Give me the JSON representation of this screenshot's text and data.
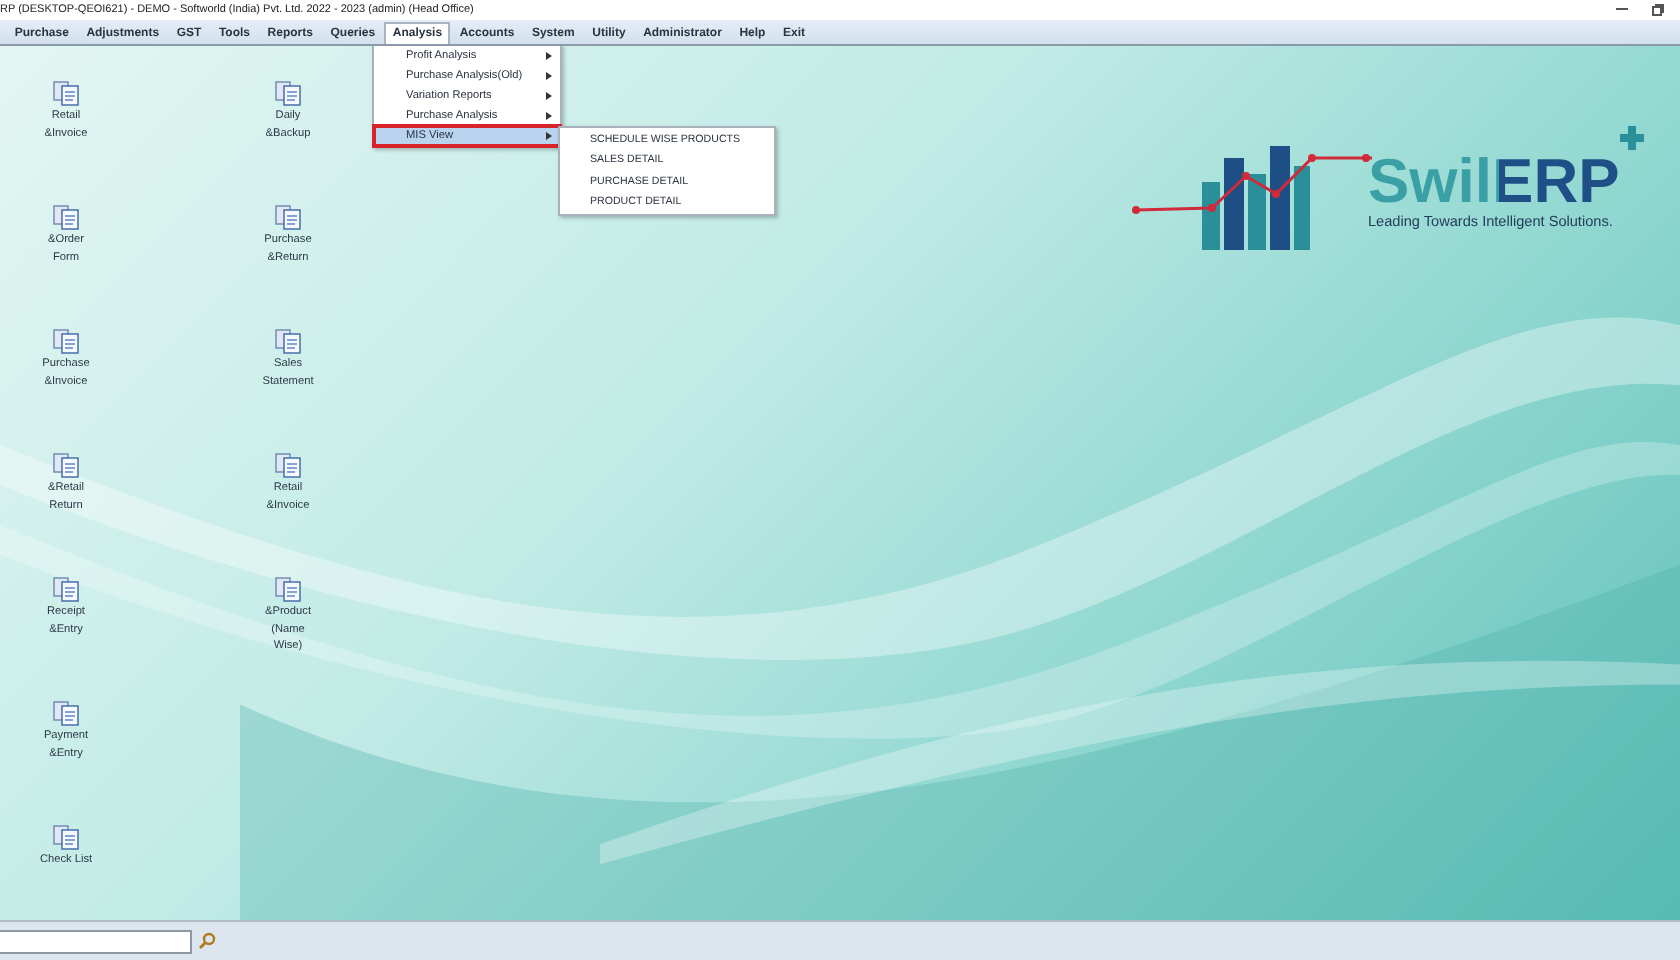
{
  "window": {
    "title": "RP (DESKTOP-QEOI621) - DEMO - Softworld (India) Pvt. Ltd. 2022 - 2023 (admin) (Head Office)"
  },
  "menu_bar": [
    {
      "label": "Purchase",
      "selected": false
    },
    {
      "label": "Adjustments",
      "selected": false
    },
    {
      "label": "GST",
      "selected": false
    },
    {
      "label": "Tools",
      "selected": false
    },
    {
      "label": "Reports",
      "selected": false
    },
    {
      "label": "Queries",
      "selected": false
    },
    {
      "label": "Analysis",
      "selected": true
    },
    {
      "label": "Accounts",
      "selected": false
    },
    {
      "label": "System",
      "selected": false
    },
    {
      "label": "Utility",
      "selected": false
    },
    {
      "label": "Administrator",
      "selected": false
    },
    {
      "label": "Help",
      "selected": false
    },
    {
      "label": "Exit",
      "selected": false
    }
  ],
  "analysis_menu": [
    {
      "label": "Profit Analysis",
      "selected": false
    },
    {
      "label": "Purchase Analysis(Old)",
      "selected": false
    },
    {
      "label": "Variation Reports",
      "selected": false
    },
    {
      "label": "Purchase Analysis",
      "selected": false
    },
    {
      "label": "MIS View",
      "selected": true
    }
  ],
  "mis_view_menu": [
    "SCHEDULE WISE PRODUCTS",
    "SALES DETAIL",
    "PURCHASE DETAIL",
    "PRODUCT DETAIL"
  ],
  "shortcuts": [
    [
      "Retail",
      "&Invoice"
    ],
    [
      "&Order",
      "Form"
    ],
    [
      "Purchase",
      "&Invoice"
    ],
    [
      "&Retail",
      "Return"
    ],
    [
      "Receipt",
      "&Entry"
    ],
    [
      "Payment",
      "&Entry"
    ],
    [
      "Check List"
    ],
    [
      "Daily",
      "&Backup"
    ],
    [
      "Purchase",
      "&Return"
    ],
    [
      "Sales",
      "Statement"
    ],
    [
      "Retail",
      "&Invoice"
    ],
    [
      "&Product",
      "(Name",
      "Wise)"
    ]
  ],
  "logo": {
    "name": "SwilERP",
    "tagline": "Leading Towards Intelligent Solutions."
  }
}
